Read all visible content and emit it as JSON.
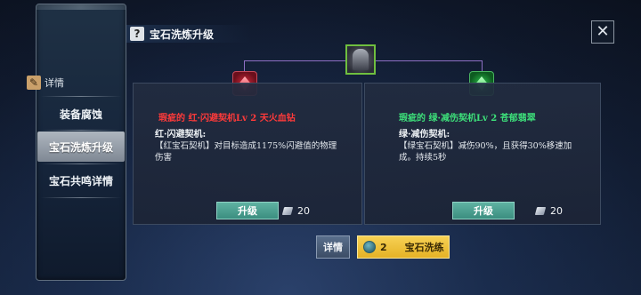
{
  "title": "宝石洗炼升级",
  "close_symbol": "✕",
  "sidebar": {
    "detail_label": "详情",
    "items": [
      {
        "label": "装备腐蚀",
        "active": false
      },
      {
        "label": "宝石洗炼升级",
        "active": true
      },
      {
        "label": "宝石共鸣详情",
        "active": false
      }
    ]
  },
  "cards": {
    "left": {
      "gem_color": "#e8273a",
      "name": "瑕疵的 红·闪避契机Lv 2 天火血钻",
      "subtitle": "红·闪避契机:",
      "description": "【红宝石契机】对目标造成1175%闪避值的物理伤害",
      "upgrade_label": "升级",
      "cost": "20"
    },
    "right": {
      "gem_color": "#2ad64a",
      "name": "瑕疵的 绿·减伤契机Lv 2 苍郁翡翠",
      "subtitle": "绿·减伤契机:",
      "description": "【绿宝石契机】减伤90%，且获得30%移速加成。持续5秒",
      "upgrade_label": "升级",
      "cost": "20"
    }
  },
  "bottom": {
    "detail_label": "详情",
    "wash_count": "2",
    "wash_label": "宝石洗练"
  },
  "colors": {
    "accent_teal": "#4aa092",
    "accent_gold": "#f2c640",
    "connector": "#8e6fc4"
  }
}
